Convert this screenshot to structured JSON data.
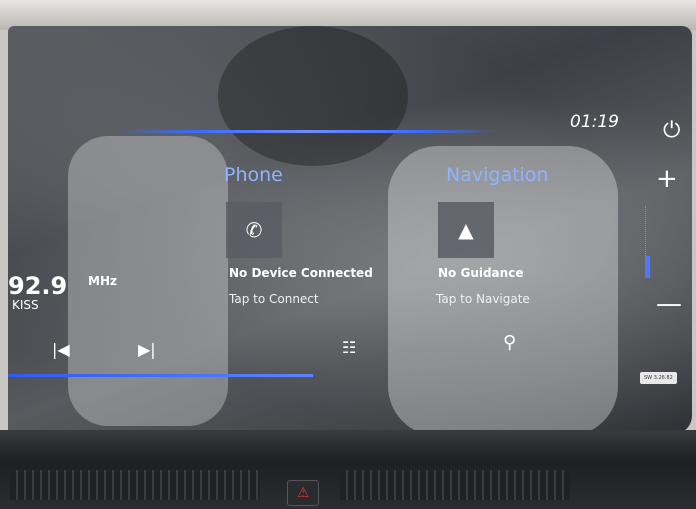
{
  "status": {
    "time": "01:19"
  },
  "radio": {
    "frequency": "92.9",
    "unit": "MHz",
    "station": "KISS"
  },
  "phone": {
    "title": "Phone",
    "status": "No Device Connected",
    "action": "Tap to Connect"
  },
  "navigation": {
    "title": "Navigation",
    "status": "No Guidance",
    "action": "Tap to Navigate"
  },
  "badge": "SW 3.26.82",
  "colors": {
    "accent": "#4d79ff",
    "tile_title": "#8fb4ff"
  },
  "icons": [
    "power-icon",
    "plus-icon",
    "minus-icon",
    "phone-icon",
    "navigation-arrow-icon",
    "previous-track-icon",
    "next-track-icon",
    "source-list-icon",
    "search-icon",
    "hazard-icon"
  ]
}
